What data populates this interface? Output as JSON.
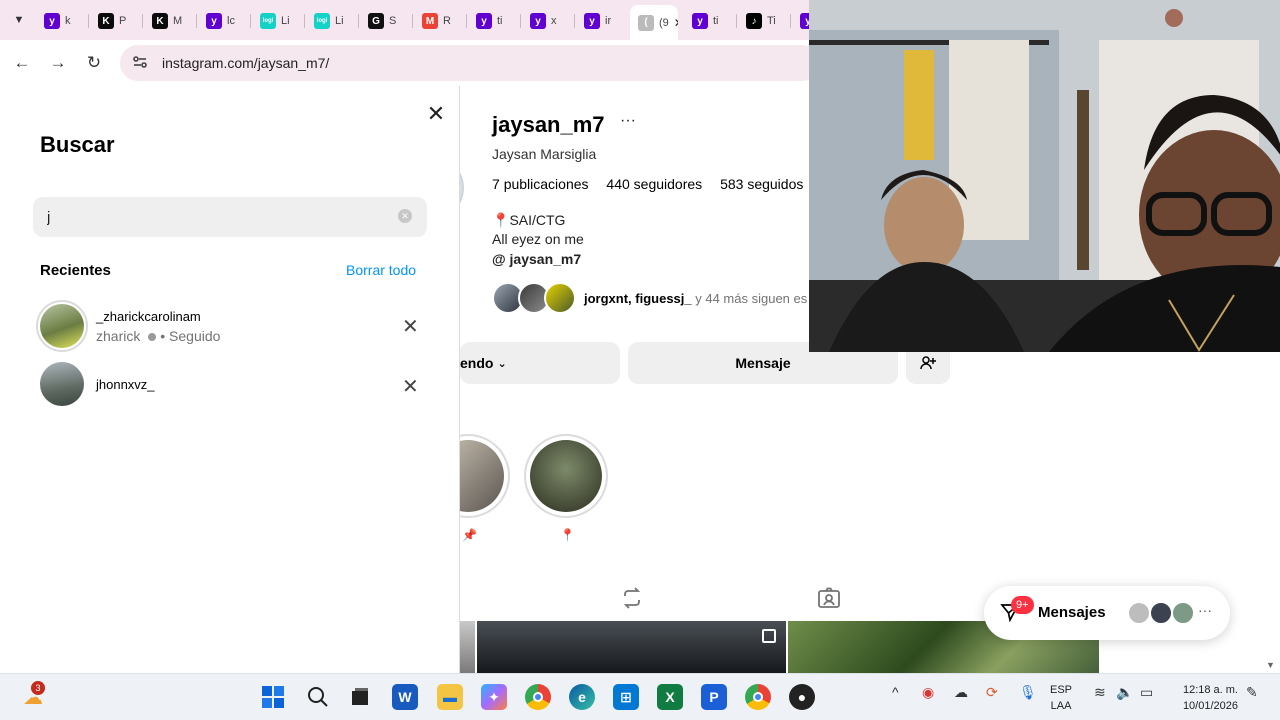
{
  "browser": {
    "tabs": [
      {
        "letter": "y",
        "text": "k",
        "color": "#6001d2"
      },
      {
        "letter": "K",
        "text": "P",
        "color": "#0b0b0b"
      },
      {
        "letter": "K",
        "text": "M",
        "color": "#0b0b0b"
      },
      {
        "letter": "y",
        "text": "lc",
        "color": "#6001d2"
      },
      {
        "letter": "logi",
        "text": "Li",
        "color": "#14d3c6"
      },
      {
        "letter": "logi",
        "text": "Li",
        "color": "#14d3c6"
      },
      {
        "letter": "G",
        "text": "S",
        "color": "#111111"
      },
      {
        "letter": "M",
        "text": "R",
        "color": "#ea4335"
      },
      {
        "letter": "y",
        "text": "ti",
        "color": "#6001d2"
      },
      {
        "letter": "y",
        "text": "x",
        "color": "#6001d2"
      },
      {
        "letter": "y",
        "text": "ir",
        "color": "#6001d2"
      },
      {
        "letter": "(",
        "text": "(9",
        "color": "#bbbbbb"
      },
      {
        "letter": "y",
        "text": "ti",
        "color": "#6001d2"
      },
      {
        "letter": "♪",
        "text": "Ti",
        "color": "#000000"
      },
      {
        "letter": "y",
        "text": "",
        "color": "#6001d2"
      }
    ],
    "active_tab_close": "✕",
    "url": "instagram.com/jaysan_m7/"
  },
  "search": {
    "title": "Buscar",
    "query": "j",
    "recent_title": "Recientes",
    "clear_all": "Borrar todo",
    "recent": [
      {
        "username": "_zharickcarolinam",
        "name": "zharick",
        "status": "• Seguido"
      },
      {
        "username": "jhonnxvz_",
        "name": "",
        "status": ""
      }
    ]
  },
  "profile": {
    "username": "jaysan_m7",
    "more": "···",
    "full_name": "Jaysan Marsiglia",
    "posts": "7",
    "posts_label": "publicaciones",
    "followers": "440",
    "followers_label": "seguidores",
    "following": "583",
    "following_label": "seguidos",
    "bio_location": "SAI/CTG",
    "bio_text": "All eyez on me",
    "threads_handle": "jaysan_m7",
    "followed_by_names": "jorgxnt, figuessj_",
    "followed_by_rest": " y 44 más siguen es",
    "following_button": "endo",
    "message_button": "Mensaje",
    "highlights": [
      "📌",
      "📍"
    ]
  },
  "messages_pill": {
    "badge": "9+",
    "label": "Mensajes",
    "more": "···"
  },
  "taskbar": {
    "weather_badge": "3",
    "language_top": "ESP",
    "language_bottom": "LAA",
    "time": "12:18 a. m.",
    "date": "10/01/2026"
  }
}
